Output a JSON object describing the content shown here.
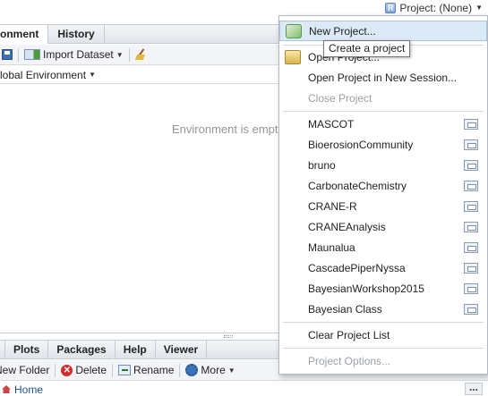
{
  "topbar": {
    "project_button": "Project: (None)",
    "project_icon": "project-r-icon"
  },
  "upper": {
    "tabs": [
      "onment",
      "History"
    ],
    "toolbar": {
      "import_label": "Import Dataset"
    },
    "env_selector": "lobal Environment",
    "empty_message": "Environment is empt"
  },
  "lower": {
    "tabs": [
      "Plots",
      "Packages",
      "Help",
      "Viewer"
    ],
    "toolbar": {
      "new_folder": "New Folder",
      "delete": "Delete",
      "rename": "Rename",
      "more": "More"
    },
    "path_home": "Home"
  },
  "menu": {
    "new_project": "New Project...",
    "open_project": "Open Project...",
    "open_new_session": "Open Project in New Session...",
    "close_project": "Close Project",
    "recent": [
      "MASCOT",
      "BioerosionCommunity",
      "bruno",
      "CarbonateChemistry",
      "CRANE-R",
      "CRANEAnalysis",
      "Maunalua",
      "CascadePiperNyssa",
      "BayesianWorkshop2015",
      "Bayesian Class"
    ],
    "clear_list": "Clear Project List",
    "project_options": "Project Options..."
  },
  "tooltip": "Create a project",
  "colors": {
    "menu_highlight": "#dce9f7",
    "disabled_text": "#9aa0a6",
    "tooltip_border": "#767676"
  }
}
